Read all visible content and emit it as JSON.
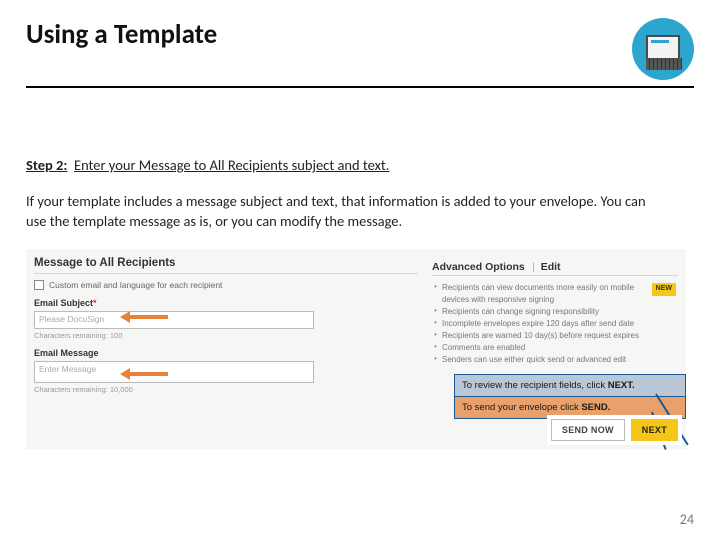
{
  "title": "Using a Template",
  "step": {
    "label": "Step 2:",
    "text": "Enter your Message to All Recipients subject and text."
  },
  "explain": "If your template includes a message subject and text, that information is added to your envelope. You can use the template message as is, or you can modify the message.",
  "shot": {
    "section_title": "Message to All Recipients",
    "custom_chk_label": "Custom email and language for each recipient",
    "subject_label": "Email Subject",
    "subject_placeholder": "Please DocuSign",
    "subject_counter": "Characters remaining: 100",
    "message_label": "Email Message",
    "message_placeholder": "Enter Message",
    "message_counter": "Characters remaining: 10,000",
    "adv_title": "Advanced Options",
    "adv_edit": "Edit",
    "bullets": [
      "Recipients can view documents more easily on mobile devices with responsive signing",
      "Recipients can change signing responsibility",
      "Incomplete envelopes expire 120 days after send date",
      "Recipients are warned 10 day(s) before request expires",
      "Comments are enabled",
      "Senders can use either quick send or advanced edit"
    ],
    "new_badge": "NEW",
    "callout_top_a": "To review the recipient fields, click ",
    "callout_top_b": "NEXT.",
    "callout_bot_a": "To send your envelope click ",
    "callout_bot_b": "SEND.",
    "btn_send": "SEND NOW",
    "btn_next": "NEXT"
  },
  "pagenum": "24"
}
